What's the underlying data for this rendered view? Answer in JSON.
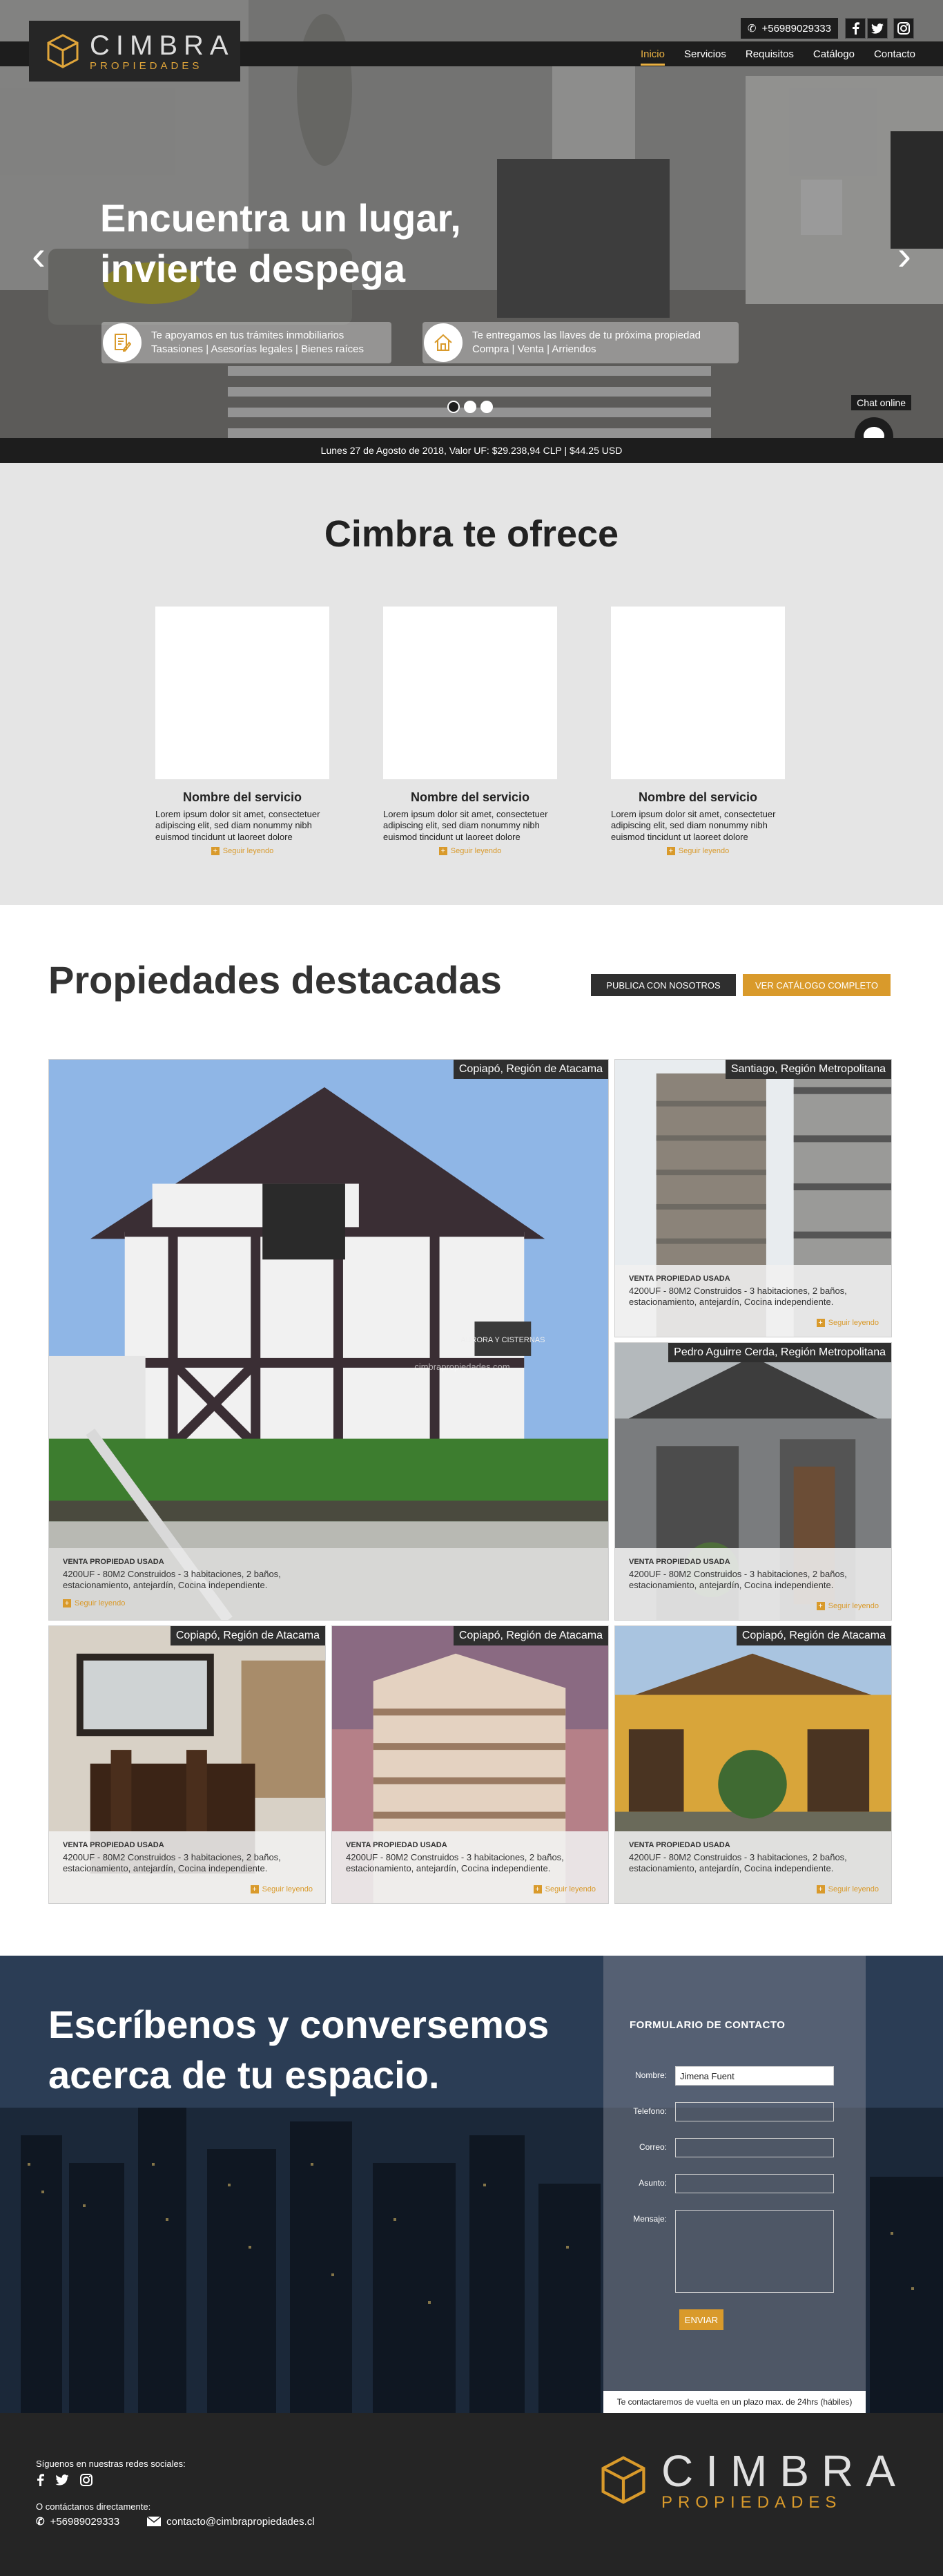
{
  "header": {
    "logo_title": "CIMBRA",
    "logo_subtitle": "PROPIEDADES",
    "phone": "+56989029333",
    "nav": [
      "Inicio",
      "Servicios",
      "Requisitos",
      "Catálogo",
      "Contacto"
    ],
    "active_nav": "Inicio"
  },
  "hero": {
    "title_line1": "Encuentra un lugar,",
    "title_line2": "invierte despega",
    "pill1_line1": "Te apoyamos en tus trámites inmobiliarios",
    "pill1_line2": "Tasasiones | Asesorías legales | Bienes raíces",
    "pill2_line1": "Te entregamos las llaves de tu próxima propiedad",
    "pill2_line2": "Compra | Venta | Arriendos",
    "chat_label": "Chat online",
    "uf_text": "Lunes 27 de Agosto de 2018, Valor UF: $29.238,94 CLP | $44.25 USD"
  },
  "offer": {
    "title": "Cimbra te ofrece",
    "services": [
      {
        "name": "Nombre del servicio",
        "desc": "Lorem ipsum dolor sit amet, consectetuer adipiscing elit, sed diam nonummy nibh euismod tincidunt ut laoreet dolore",
        "more": "Seguir leyendo"
      },
      {
        "name": "Nombre del servicio",
        "desc": "Lorem ipsum dolor sit amet, consectetuer adipiscing elit, sed diam nonummy nibh euismod tincidunt ut laoreet dolore",
        "more": "Seguir leyendo"
      },
      {
        "name": "Nombre del servicio",
        "desc": "Lorem ipsum dolor sit amet, consectetuer adipiscing elit, sed diam nonummy nibh euismod tincidunt ut laoreet dolore",
        "more": "Seguir leyendo"
      }
    ]
  },
  "featured": {
    "title": "Propiedades destacadas",
    "btn_publish": "PUBLICA CON NOSOTROS",
    "btn_catalog": "VER CATÁLOGO COMPLETO",
    "watermark": "cimbrapropiedades.com",
    "sign": "AURORA Y CISTERNAS",
    "properties": [
      {
        "location": "Copiapó, Región de Atacama",
        "type": "VENTA PROPIEDAD USADA",
        "desc1": "4200UF - 80M2 Construidos  -  3 habitaciones, 2 baños,",
        "desc2": "estacionamiento, antejardín, Cocina independiente.",
        "more": "Seguir leyendo"
      },
      {
        "location": "Santiago, Región Metropolitana",
        "type": "VENTA PROPIEDAD USADA",
        "desc1": "4200UF - 80M2 Construidos  -  3 habitaciones, 2 baños,",
        "desc2": "estacionamiento, antejardín, Cocina independiente.",
        "more": "Seguir leyendo"
      },
      {
        "location": "Pedro Aguirre Cerda, Región Metropolitana",
        "type": "VENTA PROPIEDAD USADA",
        "desc1": "4200UF - 80M2 Construidos  -  3 habitaciones, 2 baños,",
        "desc2": "estacionamiento, antejardín, Cocina independiente.",
        "more": "Seguir leyendo"
      },
      {
        "location": "Copiapó, Región de Atacama",
        "type": "VENTA PROPIEDAD USADA",
        "desc1": "4200UF - 80M2 Construidos  -  3 habitaciones, 2 baños,",
        "desc2": "estacionamiento, antejardín, Cocina independiente.",
        "more": "Seguir leyendo"
      },
      {
        "location": "Copiapó, Región de Atacama",
        "type": "VENTA PROPIEDAD USADA",
        "desc1": "4200UF - 80M2 Construidos  -  3 habitaciones, 2 baños,",
        "desc2": "estacionamiento, antejardín, Cocina independiente.",
        "more": "Seguir leyendo"
      },
      {
        "location": "Copiapó, Región de Atacama",
        "type": "VENTA PROPIEDAD USADA",
        "desc1": "4200UF - 80M2 Construidos  -  3 habitaciones, 2 baños,",
        "desc2": "estacionamiento, antejardín, Cocina independiente.",
        "more": "Seguir leyendo"
      }
    ]
  },
  "contact": {
    "title_line1": "Escríbenos y conversemos",
    "title_line2": "acerca de tu espacio.",
    "form_title": "FORMULARIO DE CONTACTO",
    "label_name": "Nombre:",
    "label_phone": "Telefono:",
    "label_email": "Correo:",
    "label_subject": "Asunto:",
    "label_message": "Mensaje:",
    "name_value": "Jimena Fuent",
    "send": "ENVIAR",
    "note": "Te contactaremos de vuelta en un plazo max. de 24hrs (hábiles)"
  },
  "footer": {
    "social_label": "Síguenos en nuestras redes sociales:",
    "contact_label": "O contáctanos directamente:",
    "phone": "+56989029333",
    "email": "contacto@cimbrapropiedades.cl",
    "logo_title": "CIMBRA",
    "logo_subtitle": "PROPIEDADES"
  },
  "colors": {
    "accent": "#d99a2b",
    "dark": "#1d1d1d",
    "offer_bg": "#e5e5e5"
  }
}
